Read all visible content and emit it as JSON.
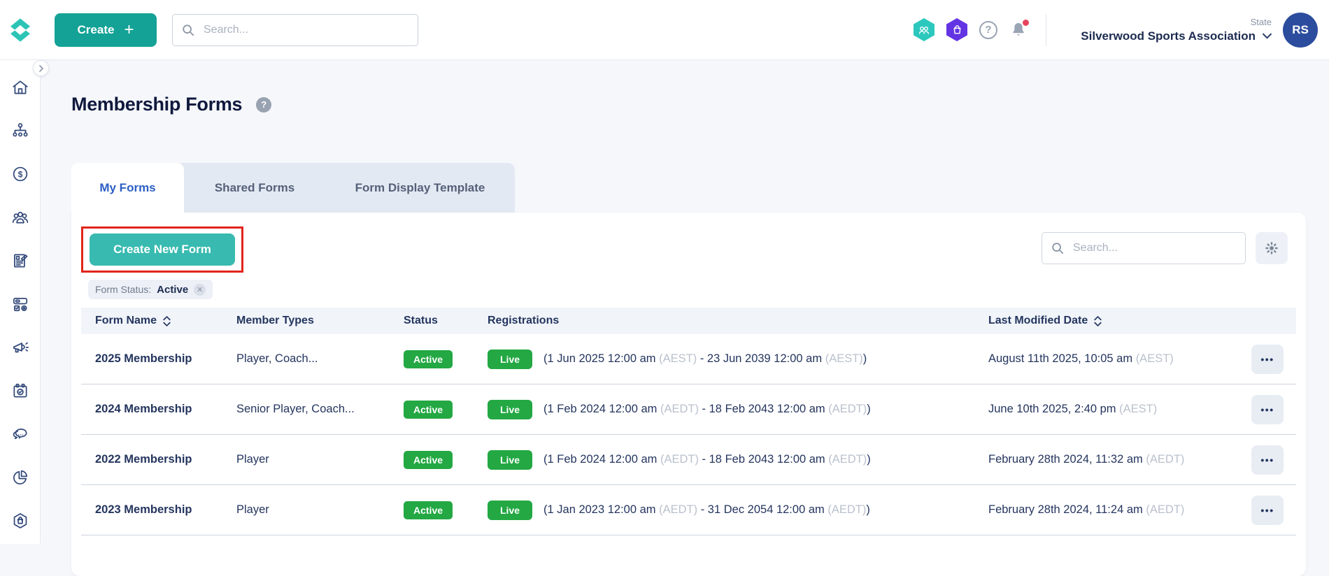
{
  "topbar": {
    "create_button": "Create",
    "plus": "+",
    "search_placeholder": "Search...",
    "context_label": "State",
    "org_name": "Silverwood Sports Association",
    "avatar_initials": "RS"
  },
  "sidebar": {
    "icons": [
      "home",
      "org-chart",
      "finance",
      "members",
      "registration-form",
      "products",
      "marketing",
      "events",
      "messages",
      "reports",
      "shop"
    ]
  },
  "page": {
    "title": "Membership Forms",
    "help": "?"
  },
  "tabs": [
    {
      "label": "My Forms",
      "active": true
    },
    {
      "label": "Shared Forms",
      "active": false
    },
    {
      "label": "Form Display Template",
      "active": false
    }
  ],
  "toolbar": {
    "create_new_form": "Create New Form",
    "search_placeholder": "Search..."
  },
  "filter": {
    "label": "Form Status:",
    "value": "Active",
    "remove": "✕"
  },
  "table": {
    "columns": [
      {
        "label": "Form Name",
        "sortable": true
      },
      {
        "label": "Member Types",
        "sortable": false
      },
      {
        "label": "Status",
        "sortable": false
      },
      {
        "label": "Registrations",
        "sortable": false
      },
      {
        "label": "Last Modified Date",
        "sortable": true
      }
    ],
    "rows": [
      {
        "form_name": "2025 Membership",
        "member_types": "Player, Coach...",
        "status": "Active",
        "registration_status": "Live",
        "reg_p1": "(1 Jun 2025 12:00 am ",
        "reg_tz1": "(AEST)",
        "reg_p2": " - 23 Jun 2039 12:00 am ",
        "reg_tz2": "(AEST)",
        "reg_p3": ")",
        "last_modified": "August 11th 2025, 10:05 am ",
        "last_modified_tz": "(AEST)"
      },
      {
        "form_name": "2024 Membership",
        "member_types": "Senior Player, Coach...",
        "status": "Active",
        "registration_status": "Live",
        "reg_p1": "(1 Feb 2024 12:00 am ",
        "reg_tz1": "(AEDT)",
        "reg_p2": " - 18 Feb 2043 12:00 am ",
        "reg_tz2": "(AEDT)",
        "reg_p3": ")",
        "last_modified": "June 10th 2025, 2:40 pm ",
        "last_modified_tz": "(AEST)"
      },
      {
        "form_name": "2022 Membership",
        "member_types": "Player",
        "status": "Active",
        "registration_status": "Live",
        "reg_p1": "(1 Feb 2024 12:00 am ",
        "reg_tz1": "(AEDT)",
        "reg_p2": " - 18 Feb 2043 12:00 am ",
        "reg_tz2": "(AEDT)",
        "reg_p3": ")",
        "last_modified": "February 28th 2024, 11:32 am ",
        "last_modified_tz": "(AEDT)"
      },
      {
        "form_name": "2023 Membership",
        "member_types": "Player",
        "status": "Active",
        "registration_status": "Live",
        "reg_p1": "(1 Jan 2023 12:00 am ",
        "reg_tz1": "(AEDT)",
        "reg_p2": " - 31 Dec 2054 12:00 am ",
        "reg_tz2": "(AEDT)",
        "reg_p3": ")",
        "last_modified": "February 28th 2024, 11:24 am ",
        "last_modified_tz": "(AEDT)"
      }
    ]
  },
  "colors": {
    "teal": "#14a296",
    "teal_light": "#38bab0",
    "green": "#23a843",
    "navy": "#24355e",
    "annotation_red": "#e1251b",
    "purple_hex": "#6334e3",
    "teal_hex": "#2cc8bd",
    "avatar_blue": "#2c4d9d",
    "active_tab_blue": "#2c5fc4"
  }
}
